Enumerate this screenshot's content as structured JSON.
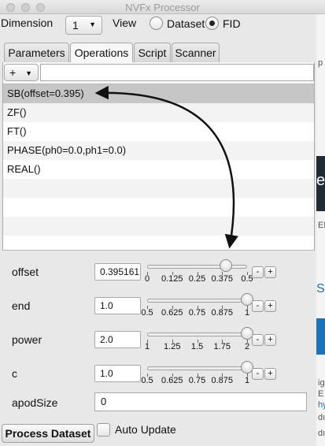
{
  "window": {
    "title": "NVFx Processor"
  },
  "toolbar": {
    "dimension_label": "Dimension",
    "dimension_value": "1",
    "view_label": "View",
    "view_options": [
      {
        "label": "Dataset",
        "selected": false
      },
      {
        "label": "FID",
        "selected": true
      }
    ]
  },
  "tabs": [
    {
      "label": "Parameters",
      "active": false
    },
    {
      "label": "Operations",
      "active": true
    },
    {
      "label": "Script",
      "active": false
    },
    {
      "label": "Scanner",
      "active": false
    }
  ],
  "operations": {
    "add_label": "+",
    "new_op_value": "",
    "items": [
      {
        "label": "SB(offset=0.395)",
        "selected": true
      },
      {
        "label": "ZF()",
        "selected": false
      },
      {
        "label": "FT()",
        "selected": false
      },
      {
        "label": "PHASE(ph0=0.0,ph1=0.0)",
        "selected": false
      },
      {
        "label": "REAL()",
        "selected": false
      }
    ]
  },
  "params": [
    {
      "name": "offset",
      "value": "0.395161",
      "ticks": [
        "0",
        "0.125",
        "0.25",
        "0.375",
        "0.5"
      ],
      "min": 0,
      "max": 0.5,
      "current": 0.395161
    },
    {
      "name": "end",
      "value": "1.0",
      "ticks": [
        "0.5",
        "0.625",
        "0.75",
        "0.875",
        "1"
      ],
      "min": 0.5,
      "max": 1,
      "current": 1.0
    },
    {
      "name": "power",
      "value": "2.0",
      "ticks": [
        "1",
        "1.25",
        "1.5",
        "1.75",
        "2"
      ],
      "min": 1,
      "max": 2,
      "current": 2.0
    },
    {
      "name": "c",
      "value": "1.0",
      "ticks": [
        "0.5",
        "0.625",
        "0.75",
        "0.875",
        "1"
      ],
      "min": 0.5,
      "max": 1,
      "current": 1.0
    }
  ],
  "stepper": {
    "minus": "-",
    "plus": "+"
  },
  "apod": {
    "label": "apodSize",
    "value": "0"
  },
  "footer": {
    "process_label": "Process Dataset",
    "auto_update_label": "Auto Update",
    "auto_update_checked": false
  },
  "background_window": {
    "fragments": [
      "p",
      "e",
      "EN",
      "S",
      "ig",
      "E",
      "hy",
      "dı",
      "dı"
    ]
  }
}
